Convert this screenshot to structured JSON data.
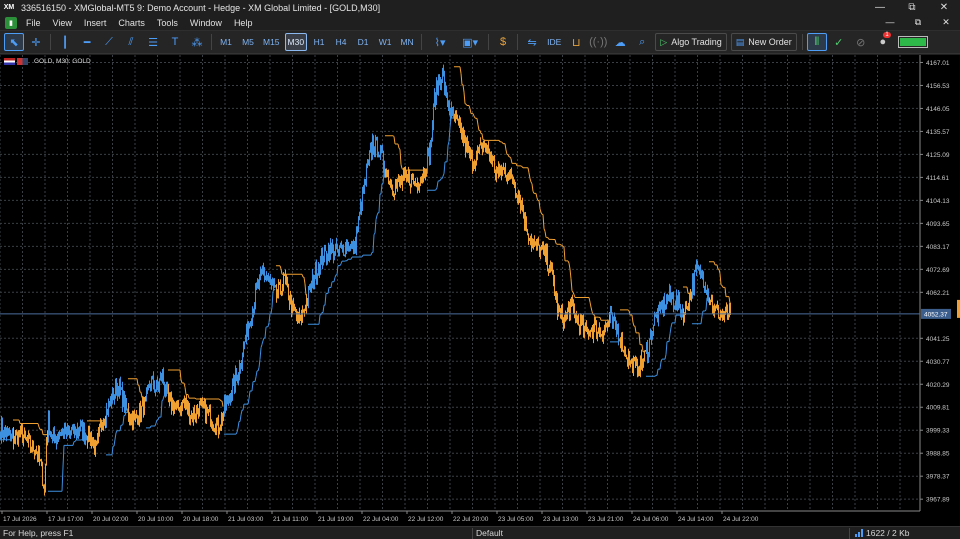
{
  "window": {
    "logo": "XM",
    "title": "336516150 - XMGlobal-MT5 9: Demo Account - Hedge - XM Global Limited - [GOLD,M30]",
    "controls": {
      "minimize": "—",
      "restore": "⧉",
      "close": "✕"
    }
  },
  "menu": {
    "items": [
      "File",
      "View",
      "Insert",
      "Charts",
      "Tools",
      "Window",
      "Help"
    ],
    "controls": {
      "minimize": "—",
      "restore": "⧉",
      "close": "✕"
    }
  },
  "toolbar": {
    "timeframes": [
      "M1",
      "M5",
      "M15",
      "M30",
      "H1",
      "H4",
      "D1",
      "W1",
      "MN"
    ],
    "active_timeframe": "M30",
    "ide_label": "IDE",
    "algo_trading_label": "Algo Trading",
    "new_order_label": "New Order",
    "notification_count": "1"
  },
  "chart": {
    "symbol_label": "GOLD, M30: GOLD",
    "current_price": "4052.37",
    "colors": {
      "up": "#3d8fe0",
      "down": "#f0a030",
      "grid": "#3a3f45",
      "price_line": "#4b6e9e"
    },
    "price_axis": [
      "4167.01",
      "4156.53",
      "4146.05",
      "4135.57",
      "4125.09",
      "4114.61",
      "4104.13",
      "4093.65",
      "4083.17",
      "4072.69",
      "4062.21",
      "4041.25",
      "4030.77",
      "4020.29",
      "4009.81",
      "3999.33",
      "3988.85",
      "3978.37",
      "3967.89"
    ],
    "time_axis": [
      "17 Jul 2026",
      "17 Jul 17:00",
      "20 Jul 02:00",
      "20 Jul 10:00",
      "20 Jul 18:00",
      "21 Jul 03:00",
      "21 Jul 11:00",
      "21 Jul 19:00",
      "22 Jul 04:00",
      "22 Jul 12:00",
      "22 Jul 20:00",
      "23 Jul 05:00",
      "23 Jul 13:00",
      "23 Jul 21:00",
      "24 Jul 06:00",
      "24 Jul 14:00",
      "24 Jul 22:00"
    ]
  },
  "chart_data": {
    "type": "line",
    "title": "GOLD, M30: GOLD",
    "ylim": [
      3962.5,
      4169.5
    ],
    "y_ticks": [
      4167.01,
      4156.53,
      4146.05,
      4135.57,
      4125.09,
      4114.61,
      4104.13,
      4093.65,
      4083.17,
      4072.69,
      4062.21,
      4041.25,
      4030.77,
      4020.29,
      4009.81,
      3999.33,
      3988.85,
      3978.37,
      3967.89
    ],
    "x_tick_labels": [
      "17 Jul 2026",
      "17 Jul 17:00",
      "20 Jul 02:00",
      "20 Jul 10:00",
      "20 Jul 18:00",
      "21 Jul 03:00",
      "21 Jul 11:00",
      "21 Jul 19:00",
      "22 Jul 04:00",
      "22 Jul 12:00",
      "22 Jul 20:00",
      "23 Jul 05:00",
      "23 Jul 13:00",
      "23 Jul 21:00",
      "24 Jul 06:00",
      "24 Jul 14:00",
      "24 Jul 22:00"
    ],
    "current_price": 4052.37,
    "grid": true,
    "price_waypoints": [
      [
        0,
        4000
      ],
      [
        8,
        3997
      ],
      [
        14,
        3995
      ],
      [
        20,
        3998
      ],
      [
        26,
        3994
      ],
      [
        30,
        3992
      ],
      [
        36,
        3990
      ],
      [
        40,
        3984
      ],
      [
        44,
        3972
      ],
      [
        46,
        3995
      ],
      [
        48,
        4003
      ],
      [
        52,
        3995
      ],
      [
        60,
        3998
      ],
      [
        70,
        3998
      ],
      [
        80,
        4000
      ],
      [
        90,
        3996
      ],
      [
        96,
        3990
      ],
      [
        100,
        4002
      ],
      [
        106,
        4008
      ],
      [
        112,
        4015
      ],
      [
        118,
        4020
      ],
      [
        126,
        4008
      ],
      [
        134,
        4004
      ],
      [
        140,
        4008
      ],
      [
        146,
        4012
      ],
      [
        150,
        4022
      ],
      [
        156,
        4018
      ],
      [
        162,
        4024
      ],
      [
        168,
        4012
      ],
      [
        176,
        4009
      ],
      [
        184,
        4012
      ],
      [
        192,
        4006
      ],
      [
        200,
        4010
      ],
      [
        210,
        4005
      ],
      [
        218,
        4001
      ],
      [
        224,
        4009
      ],
      [
        232,
        4018
      ],
      [
        240,
        4030
      ],
      [
        248,
        4048
      ],
      [
        256,
        4062
      ],
      [
        262,
        4072
      ],
      [
        268,
        4068
      ],
      [
        276,
        4060
      ],
      [
        284,
        4068
      ],
      [
        292,
        4054
      ],
      [
        300,
        4049
      ],
      [
        306,
        4058
      ],
      [
        314,
        4070
      ],
      [
        322,
        4078
      ],
      [
        330,
        4082
      ],
      [
        338,
        4080
      ],
      [
        346,
        4084
      ],
      [
        354,
        4082
      ],
      [
        360,
        4100
      ],
      [
        366,
        4116
      ],
      [
        372,
        4130
      ],
      [
        378,
        4128
      ],
      [
        384,
        4120
      ],
      [
        392,
        4110
      ],
      [
        400,
        4112
      ],
      [
        408,
        4114
      ],
      [
        416,
        4112
      ],
      [
        424,
        4118
      ],
      [
        430,
        4128
      ],
      [
        434,
        4150
      ],
      [
        438,
        4158
      ],
      [
        442,
        4162
      ],
      [
        446,
        4150
      ],
      [
        452,
        4142
      ],
      [
        460,
        4136
      ],
      [
        466,
        4128
      ],
      [
        472,
        4122
      ],
      [
        478,
        4126
      ],
      [
        484,
        4130
      ],
      [
        490,
        4124
      ],
      [
        496,
        4116
      ],
      [
        504,
        4118
      ],
      [
        512,
        4114
      ],
      [
        520,
        4104
      ],
      [
        526,
        4092
      ],
      [
        532,
        4084
      ],
      [
        538,
        4082
      ],
      [
        546,
        4078
      ],
      [
        552,
        4070
      ],
      [
        558,
        4052
      ],
      [
        564,
        4050
      ],
      [
        570,
        4056
      ],
      [
        578,
        4048
      ],
      [
        586,
        4044
      ],
      [
        594,
        4046
      ],
      [
        602,
        4044
      ],
      [
        610,
        4050
      ],
      [
        618,
        4044
      ],
      [
        624,
        4036
      ],
      [
        630,
        4030
      ],
      [
        636,
        4028
      ],
      [
        642,
        4030
      ],
      [
        648,
        4038
      ],
      [
        654,
        4050
      ],
      [
        660,
        4054
      ],
      [
        668,
        4060
      ],
      [
        676,
        4058
      ],
      [
        684,
        4052
      ],
      [
        690,
        4062
      ],
      [
        696,
        4072
      ],
      [
        702,
        4070
      ],
      [
        708,
        4062
      ],
      [
        714,
        4054
      ],
      [
        722,
        4052
      ],
      [
        730,
        4052
      ]
    ]
  },
  "status": {
    "help_text": "For Help, press F1",
    "profile": "Default",
    "connection": "1622 / 2 Kb"
  }
}
